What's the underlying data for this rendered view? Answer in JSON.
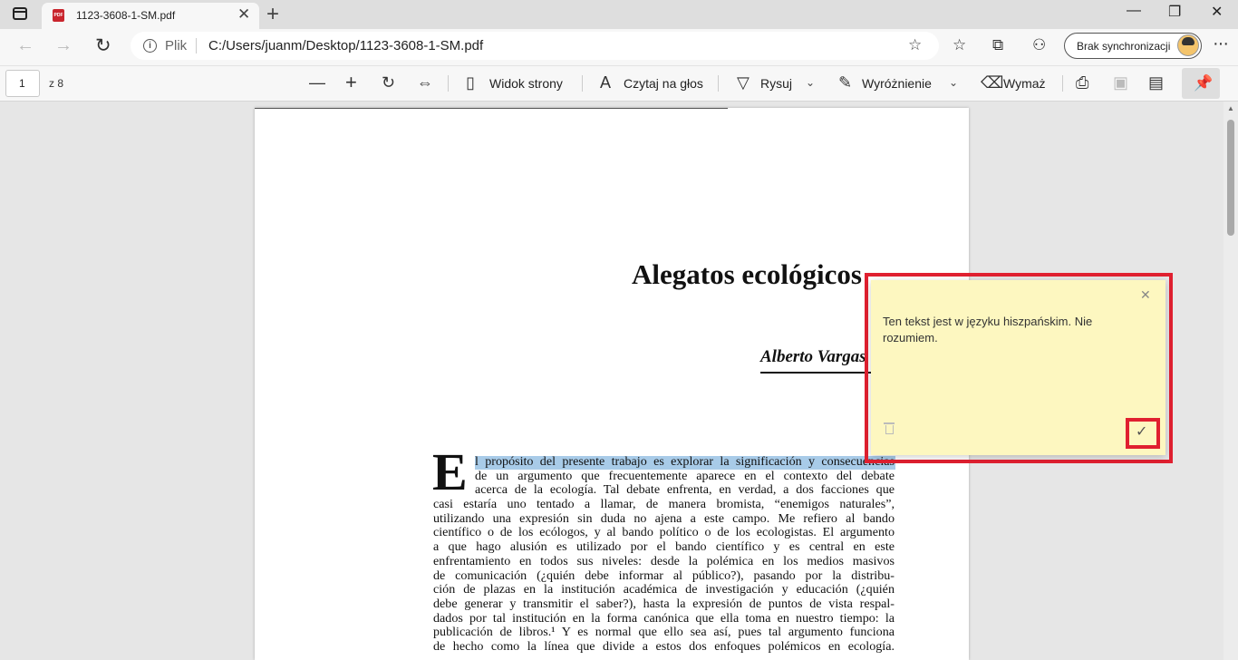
{
  "browser": {
    "tab_title": "1123-3608-1-SM.pdf",
    "address_label": "Plik",
    "url": "C:/Users/juanm/Desktop/1123-3608-1-SM.pdf",
    "sync_label": "Brak synchronizacji"
  },
  "pdf_toolbar": {
    "page_input": "1",
    "page_count": "z 8",
    "page_view_label": "Widok strony",
    "read_aloud_label": "Czytaj na głos",
    "draw_label": "Rysuj",
    "highlight_label": "Wyróżnienie",
    "erase_label": "Wymaż"
  },
  "document": {
    "title": "Alegatos ecológicos",
    "author": "Alberto Vargas",
    "drop_cap": "E",
    "paragraph_lines": [
      "l propósito del presente trabajo es explorar la significación y consecuencias",
      "de un argumento que frecuentemente aparece en el contexto del debate",
      "acerca de la ecología. Tal debate enfrenta, en verdad, a dos facciones que",
      "casi estaría uno tentado a llamar, de manera bromista, “enemigos naturales”,",
      "utilizando una expresión sin duda no ajena a este campo. Me refiero al bando",
      "científico o de los ecólogos, y al bando político o de los ecologistas. El argumento",
      "a que hago alusión es utilizado por el bando científico y es central en este",
      "enfrentamiento en todos sus niveles: desde la polémica en los medios masivos",
      "de comunicación (¿quién debe informar al público?), pasando por la distribu-",
      "ción de plazas en la institución académica de investigación y educación (¿quién",
      "debe generar y transmitir el saber?), hasta la expresión de puntos de vista respal-",
      "dados por tal institución en la forma canónica que ella toma en nuestro tiempo: la",
      "publicación de libros.¹ Y es normal que ello sea así, pues tal argumento funciona",
      "de hecho como la línea que divide a estos dos enfoques polémicos en ecología."
    ]
  },
  "note": {
    "text": "Ten tekst jest w języku hiszpańskim. Nie rozumiem."
  }
}
